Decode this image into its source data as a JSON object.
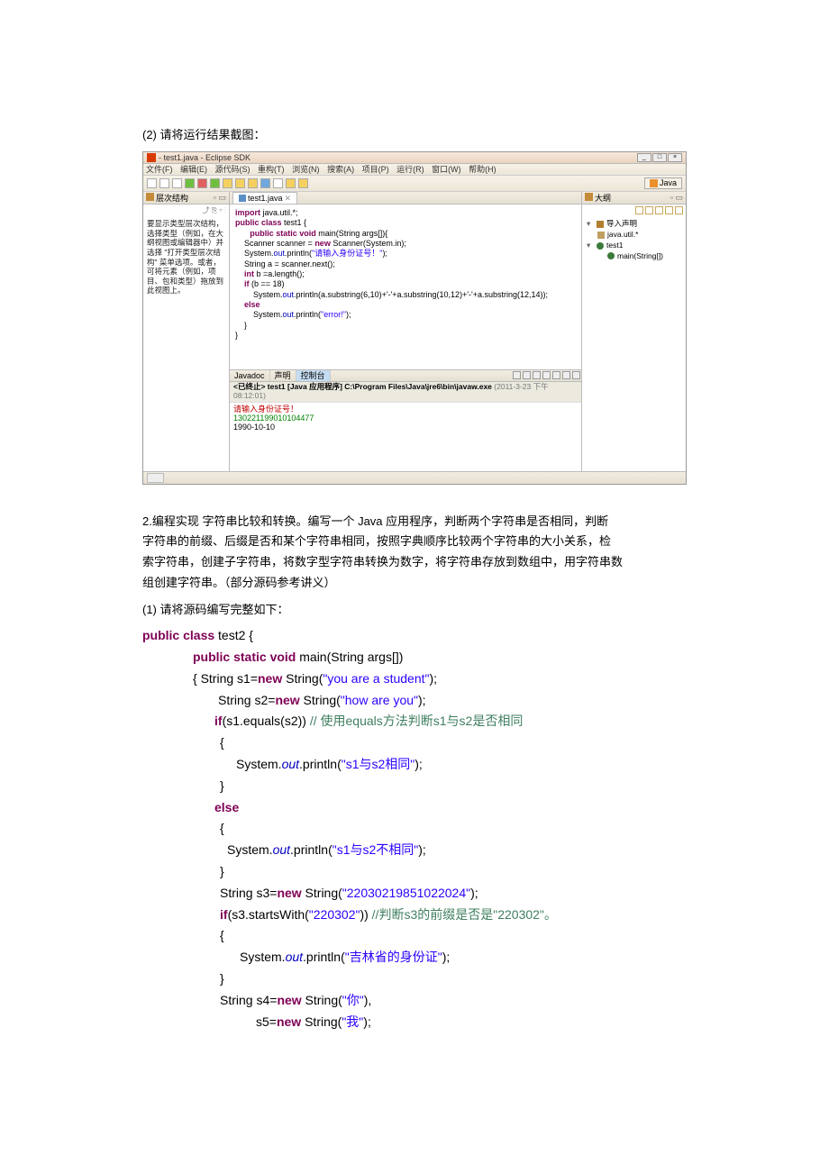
{
  "doc": {
    "caption2": "(2) 请将运行结果截图：",
    "prose2_l1": "2.编程实现 字符串比较和转换。编写一个 Java 应用程序，判断两个字符串是否相同，判断",
    "prose2_l2": "字符串的前缀、后缀是否和某个字符串相同，按照字典顺序比较两个字符串的大小关系，检",
    "prose2_l3": "索字符串，创建子字符串，将数字型字符串转换为数字，将字符串存放到数组中，用字符串数",
    "prose2_l4": "组创建字符串。（部分源码参考讲义）",
    "caption1": "(1) 请将源码编写完整如下："
  },
  "ide": {
    "title": " - test1.java - Eclipse SDK",
    "menus": [
      "文件(F)",
      "编辑(E)",
      "源代码(S)",
      "重构(T)",
      "浏览(N)",
      "搜索(A)",
      "项目(P)",
      "运行(R)",
      "窗口(W)",
      "帮助(H)"
    ],
    "perspective": "Java",
    "leftpane": {
      "title": "层次结构",
      "hint": "要显示类型层次结构，选择类型（例如，在大纲视图或编辑器中）并选择 \"打开类型层次结构\" 菜单选项。或者，可将元素（例如，项目、包和类型）拖放到此视图上。"
    },
    "tab": "test1.java",
    "code": {
      "l1_a": "import",
      "l1_b": " java.util.*;",
      "l2_a": "public class",
      "l2_b": " test1 {",
      "l3_a": "public static void",
      "l3_b": " main(String args[]){",
      "l4": "    Scanner scanner = ",
      "l4_a": "new",
      "l4_b": " Scanner(System.in);",
      "l5_a": "    System.",
      "l5_out": "out",
      "l5_b": ".println(",
      "l5_s": "\"请输入身份证号！\"",
      "l5_c": ");",
      "l6": "    String a = scanner.next();",
      "l7_a": "    int",
      "l7_b": " b =a.length();",
      "l8_a": "    if",
      "l8_b": " (b == 18)",
      "l9_a": "        System.",
      "l9_out": "out",
      "l9_b": ".println(a.substring(6,10)+'-'+a.substring(10,12)+'-'+a.substring(12,14));",
      "l10": "    else",
      "l11_a": "        System.",
      "l11_out": "out",
      "l11_b": ".println(",
      "l11_s": "\"error!\"",
      "l11_c": ");",
      "l12": "    }",
      "l13": "}"
    },
    "console": {
      "tabs": [
        "Javadoc",
        "声明",
        "控制台"
      ],
      "head_a": "<已终止> test1 [Java 应用程序] C:\\Program Files\\Java\\jre6\\bin\\javaw.exe",
      "head_b": " (2011-3-23 下午08:12:01)",
      "l1": "请输入身份证号！",
      "l2": "130221199010104477",
      "l3": "1990-10-10"
    },
    "outline": {
      "title": "大纲",
      "n1": "导入声明",
      "n2": "java.util.*",
      "n3": "test1",
      "n4": "main(String[])"
    }
  },
  "src": {
    "l1_a": "public class",
    "l1_b": " test2 {",
    "l2_a": "public static void",
    "l2_b": " main(String args[])",
    "l3_a": "{   String s1=",
    "l3_b": "new",
    "l3_c": " String(",
    "l3_s": "\"you are a student\"",
    "l3_d": ");",
    "l4_a": " String    s2=",
    "l4_b": "new",
    "l4_c": " String(",
    "l4_s": "\"how are you\"",
    "l4_d": ");",
    "l5_a": "if",
    "l5_b": "(s1.equals(s2)) ",
    "l5_c": "// 使用equals方法判断s1与s2是否相同",
    "l6": " {",
    "l7_a": "    System.",
    "l7_o": "out",
    "l7_b": ".println(",
    "l7_s": "\"s1与s2相同\"",
    "l7_c": ");",
    "l8": " }",
    "l9": "else",
    "l10": " {",
    "l11_a": "   System.",
    "l11_o": "out",
    "l11_b": ".println(",
    "l11_s": "\"s1与s2不相同\"",
    "l11_c": ");",
    "l12": " }",
    "l13_a": " String s3=",
    "l13_b": "new",
    "l13_c": " String(",
    "l13_s": "\"22030219851022024\"",
    "l13_d": ");",
    "l14_a": " if",
    "l14_b": "(s3.startsWith(",
    "l14_s": "\"220302\"",
    "l14_c": "))  ",
    "l14_cm": "//判断s3的前缀是否是\"220302\"。",
    "l15": " {",
    "l16_a": "    System.",
    "l16_o": "out",
    "l16_b": ".println(",
    "l16_s": "\"吉林省的身份证\"",
    "l16_c": ");",
    "l17": " }",
    "l18_a": " String s4=",
    "l18_b": "new",
    "l18_c": " String(",
    "l18_s": "\"你\"",
    "l18_d": "),",
    "l19_a": "     s5=",
    "l19_b": "new",
    "l19_c": " String(",
    "l19_s": "\"我\"",
    "l19_d": ");"
  }
}
